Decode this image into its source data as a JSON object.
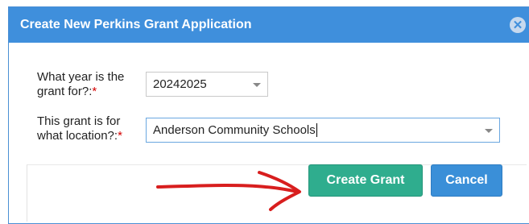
{
  "dialog": {
    "title": "Create New Perkins Grant Application",
    "close_glyph": "✕"
  },
  "form": {
    "year_label": "What year is the grant for?:",
    "year_required": "*",
    "year_value": "20242025",
    "location_label": "This grant is for what location?:",
    "location_required": "*",
    "location_value": "Anderson Community Schools"
  },
  "buttons": {
    "create_label": "Create Grant",
    "cancel_label": "Cancel"
  },
  "colors": {
    "titlebar": "#3f8fdc",
    "create_button": "#2fad8e",
    "cancel_button": "#3a8fd8",
    "required_star": "#d40000",
    "annotation_arrow": "#d81e1e"
  },
  "icons": {
    "close": "close-icon",
    "dropdown": "chevron-down-icon",
    "annotation": "arrow-annotation"
  }
}
